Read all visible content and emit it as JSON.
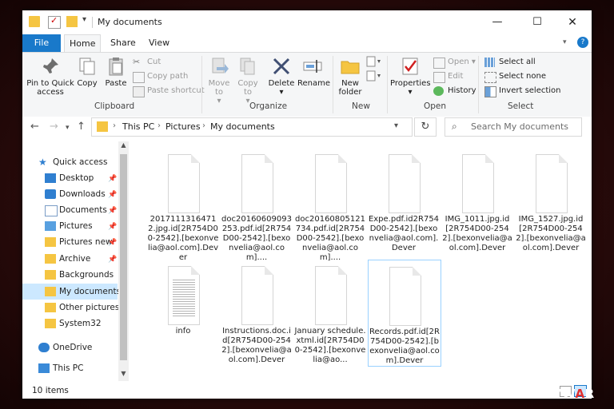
{
  "window": {
    "title": "My documents"
  },
  "ribbon_tabs": {
    "file": "File",
    "home": "Home",
    "share": "Share",
    "view": "View"
  },
  "ribbon": {
    "clipboard": {
      "label": "Clipboard",
      "pin": "Pin to Quick access",
      "copy": "Copy",
      "paste": "Paste",
      "cut": "Cut",
      "copy_path": "Copy path",
      "paste_shortcut": "Paste shortcut"
    },
    "organize": {
      "label": "Organize",
      "move_to": "Move to",
      "copy_to": "Copy to",
      "delete": "Delete",
      "rename": "Rename"
    },
    "new": {
      "label": "New",
      "new_folder": "New folder"
    },
    "open": {
      "label": "Open",
      "properties": "Properties",
      "open": "Open",
      "edit": "Edit",
      "history": "History"
    },
    "select": {
      "label": "Select",
      "select_all": "Select all",
      "select_none": "Select none",
      "invert": "Invert selection"
    }
  },
  "address": {
    "crumbs": [
      "This PC",
      "Pictures",
      "My documents"
    ],
    "search_placeholder": "Search My documents"
  },
  "nav": {
    "items": [
      {
        "label": "Quick access",
        "icon": "star-icon",
        "pinned": false
      },
      {
        "label": "Desktop",
        "icon": "desktop-icon",
        "pinned": true
      },
      {
        "label": "Downloads",
        "icon": "download-icon",
        "pinned": true
      },
      {
        "label": "Documents",
        "icon": "documents-icon",
        "pinned": true
      },
      {
        "label": "Pictures",
        "icon": "pictures-icon",
        "pinned": true
      },
      {
        "label": "Pictures new",
        "icon": "folder-icon",
        "pinned": true
      },
      {
        "label": "Archive",
        "icon": "folder-icon",
        "pinned": true
      },
      {
        "label": "Backgrounds",
        "icon": "folder-icon",
        "pinned": false
      },
      {
        "label": "My documents",
        "icon": "folder-icon",
        "pinned": false
      },
      {
        "label": "Other pictures",
        "icon": "folder-icon",
        "pinned": false
      },
      {
        "label": "System32",
        "icon": "folder-icon",
        "pinned": false
      },
      {
        "label": "OneDrive",
        "icon": "cloud-icon",
        "pinned": false
      },
      {
        "label": "This PC",
        "icon": "computer-icon",
        "pinned": false
      }
    ]
  },
  "files": [
    {
      "name": "20171113164712.jpg.id[2R754D00-2542].[bexonvelia@aol.com].Dever"
    },
    {
      "name": "doc20160609093253.pdf.id[2R754D00-2542].[bexonvelia@aol.com]...."
    },
    {
      "name": "doc20160805121734.pdf.id[2R754D00-2542].[bexonvelia@aol.com]...."
    },
    {
      "name": "Expe.pdf.id2R754D00-2542].[bexonvelia@aol.com].Dever"
    },
    {
      "name": "IMG_1011.jpg.id[2R754D00-2542].[bexonvelia@aol.com].Dever"
    },
    {
      "name": "IMG_1527.jpg.id[2R754D00-2542].[bexonvelia@aol.com].Dever"
    },
    {
      "name": "info"
    },
    {
      "name": "Instructions.doc.id[2R754D00-2542].[bexonvelia@aol.com].Dever"
    },
    {
      "name": "January schedule.xtml.id[2R754D00-2542].[bexonvelia@ao..."
    },
    {
      "name": "Records.pdf.id[2R754D00-2542].[bexonvelia@aol.com].Dever"
    }
  ],
  "status": {
    "count": "10 items"
  },
  "watermark": {
    "prefix": "2SPYW",
    "accent": "A",
    "suffix": "R"
  }
}
